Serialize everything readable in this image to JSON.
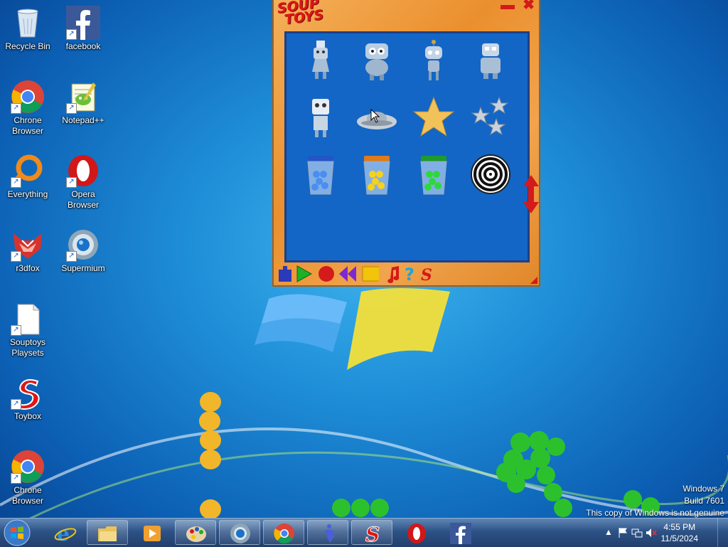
{
  "desktop": {
    "icons": [
      {
        "label": "Recycle Bin",
        "icon": "recycle-bin-icon"
      },
      {
        "label": "facebook",
        "icon": "facebook-icon"
      },
      {
        "label": "Chrone Browser",
        "icon": "chrome-icon"
      },
      {
        "label": "Notepad++",
        "icon": "notepadpp-icon"
      },
      {
        "label": "Everything",
        "icon": "everything-icon"
      },
      {
        "label": "Opera Browser",
        "icon": "opera-icon"
      },
      {
        "label": "r3dfox",
        "icon": "r3dfox-icon"
      },
      {
        "label": "Supermium",
        "icon": "supermium-icon"
      },
      {
        "label": "Souptoys Playsets",
        "icon": "file-icon"
      },
      {
        "label": "Toybox",
        "icon": "souptoys-icon"
      },
      {
        "label": "Chrone Browser",
        "icon": "chrome-icon"
      }
    ]
  },
  "souptoys": {
    "logo_line1": "SOUP",
    "logo_line2": "TOYS",
    "minimize": "▬",
    "close": "✖",
    "toys": [
      "robot-1-icon",
      "robot-2-icon",
      "robot-3-icon",
      "robot-4-icon",
      "robot-5-icon",
      "ufo-icon",
      "gold-star-icon",
      "silver-stars-icon",
      "blue-jar-icon",
      "yellow-jar-icon",
      "green-jar-icon",
      "spiral-icon"
    ],
    "toolbar": [
      "weight-icon",
      "play-icon",
      "record-icon",
      "rewind-icon",
      "stop-icon",
      "music-icon",
      "help-icon",
      "souptoys-logo-icon"
    ],
    "colors": {
      "accent": "#e01616",
      "panel": "#1366c5",
      "frame": "#eb8f2e"
    }
  },
  "watermark": {
    "line1": "Windows 7",
    "line2": "Build 7601",
    "line3": "This copy of Windows is not genuine"
  },
  "taskbar": {
    "start": "windows-start-icon",
    "items": [
      "internet-explorer-icon",
      "file-explorer-icon",
      "media-player-icon",
      "paint-icon",
      "supermium-icon",
      "chrome-icon",
      "souptoys-man-icon",
      "souptoys-icon",
      "opera-icon",
      "facebook-icon"
    ],
    "tray": {
      "arrow": "▲",
      "time": "4:55 PM",
      "date": "11/5/2024"
    }
  }
}
